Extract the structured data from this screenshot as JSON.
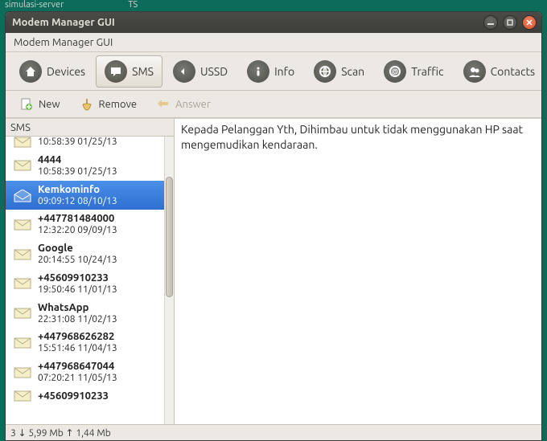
{
  "desktop": {
    "panel_left": "simulasi-server",
    "panel_right": "TS"
  },
  "window": {
    "title": "Modem Manager GUI"
  },
  "subheader": {
    "title": "Modem Manager GUI"
  },
  "toolbar": {
    "devices": "Devices",
    "sms": "SMS",
    "ussd": "USSD",
    "info": "Info",
    "scan": "Scan",
    "traffic": "Traffic",
    "contacts": "Contacts"
  },
  "actions": {
    "new": "New",
    "remove": "Remove",
    "answer": "Answer"
  },
  "sidebar": {
    "header": "SMS",
    "items": [
      {
        "sender": "",
        "time": "10:58:39 01/25/13",
        "partial": "top"
      },
      {
        "sender": "4444",
        "time": "10:58:39 01/25/13"
      },
      {
        "sender": "Kemkominfo",
        "time": "09:09:12 08/10/13",
        "selected": true
      },
      {
        "sender": "+447781484000",
        "time": "12:32:20 09/09/13"
      },
      {
        "sender": "Google",
        "time": "20:14:55 10/24/13"
      },
      {
        "sender": "+45609910233",
        "time": "19:50:46 11/01/13"
      },
      {
        "sender": "WhatsApp",
        "time": "22:31:08 11/02/13"
      },
      {
        "sender": "+447968626282",
        "time": "15:51:46 11/04/13"
      },
      {
        "sender": "+447968647044",
        "time": "07:20:21 11/05/13"
      },
      {
        "sender": "+45609910233",
        "time": "",
        "partial": "bot"
      }
    ]
  },
  "message": {
    "line1": "Kepada Pelanggan Yth,  Dihimbau untuk tidak menggunakan HP saat",
    "line2": "mengemudikan kendaraan."
  },
  "status": {
    "text": "3  ↓ 5,99 Mb  ↑ 1,44 Mb"
  }
}
